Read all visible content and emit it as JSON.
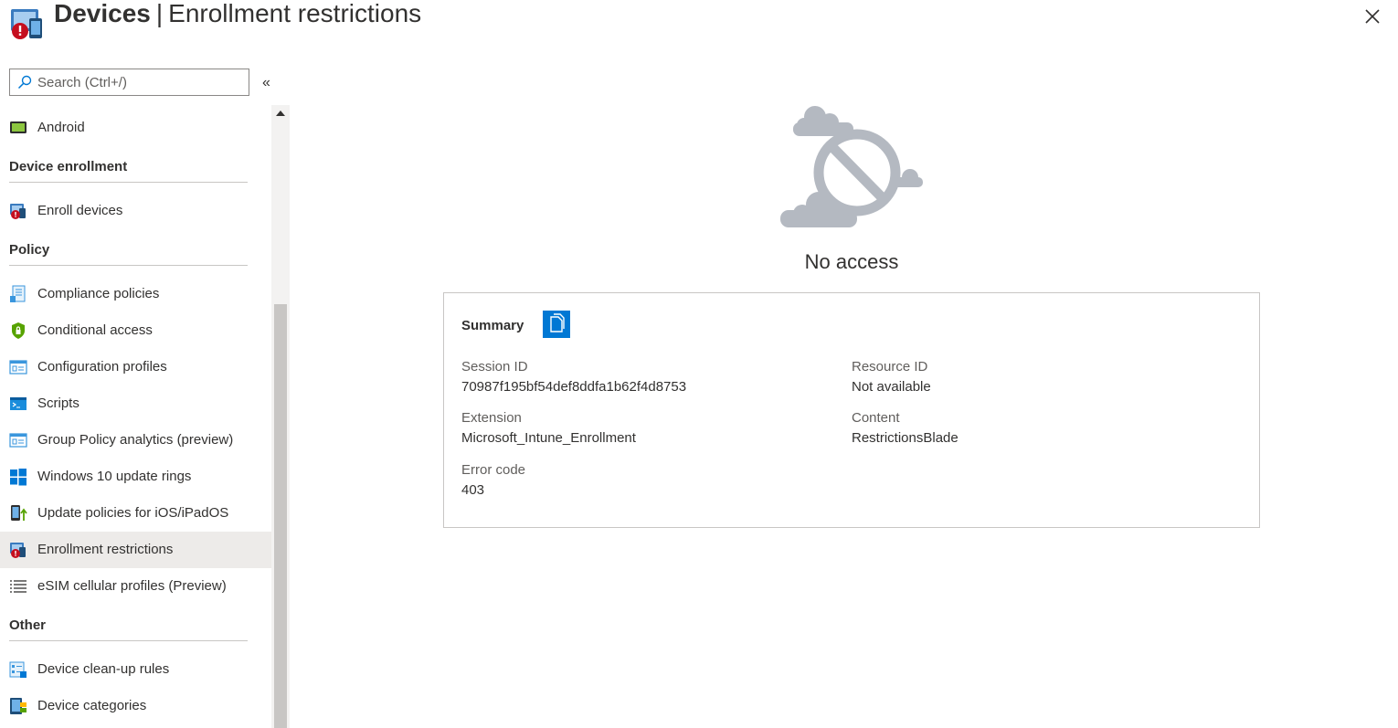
{
  "header": {
    "title_strong": "Devices",
    "separator": "|",
    "title_sub": "Enrollment restrictions",
    "icon": "devices-warning-icon",
    "close_icon": "close-icon"
  },
  "sidebar": {
    "search_placeholder": "Search (Ctrl+/)",
    "collapse_glyph": "«",
    "items": [
      {
        "type": "item",
        "label": "Android",
        "icon": "android-device-icon"
      },
      {
        "type": "section",
        "label": "Device enrollment"
      },
      {
        "type": "item",
        "label": "Enroll devices",
        "icon": "devices-warning-icon"
      },
      {
        "type": "section",
        "label": "Policy"
      },
      {
        "type": "item",
        "label": "Compliance policies",
        "icon": "compliance-document-icon"
      },
      {
        "type": "item",
        "label": "Conditional access",
        "icon": "shield-lock-icon"
      },
      {
        "type": "item",
        "label": "Configuration profiles",
        "icon": "profile-list-icon"
      },
      {
        "type": "item",
        "label": "Scripts",
        "icon": "terminal-icon"
      },
      {
        "type": "item",
        "label": "Group Policy analytics (preview)",
        "icon": "profile-list-icon"
      },
      {
        "type": "item",
        "label": "Windows 10 update rings",
        "icon": "windows-logo-icon"
      },
      {
        "type": "item",
        "label": "Update policies for iOS/iPadOS",
        "icon": "ios-update-icon"
      },
      {
        "type": "item",
        "label": "Enrollment restrictions",
        "icon": "devices-warning-icon",
        "selected": true
      },
      {
        "type": "item",
        "label": "eSIM cellular profiles (Preview)",
        "icon": "list-icon"
      },
      {
        "type": "section",
        "label": "Other"
      },
      {
        "type": "item",
        "label": "Device clean-up rules",
        "icon": "cleanup-rules-icon"
      },
      {
        "type": "item",
        "label": "Device categories",
        "icon": "device-categories-icon"
      }
    ]
  },
  "main": {
    "no_access": "No access",
    "summary": {
      "title": "Summary",
      "copy_icon": "copy-icon",
      "session_id_label": "Session ID",
      "session_id": "70987f195bf54def8ddfa1b62f4d8753",
      "resource_id_label": "Resource ID",
      "resource_id": "Not available",
      "extension_label": "Extension",
      "extension": "Microsoft_Intune_Enrollment",
      "content_label": "Content",
      "content": "RestrictionsBlade",
      "error_code_label": "Error code",
      "error_code": "403"
    }
  },
  "colors": {
    "accent": "#0078d4",
    "selected_bg": "#edebe9",
    "illustration_gray": "#b4b9c1",
    "error_red": "#d13438"
  }
}
